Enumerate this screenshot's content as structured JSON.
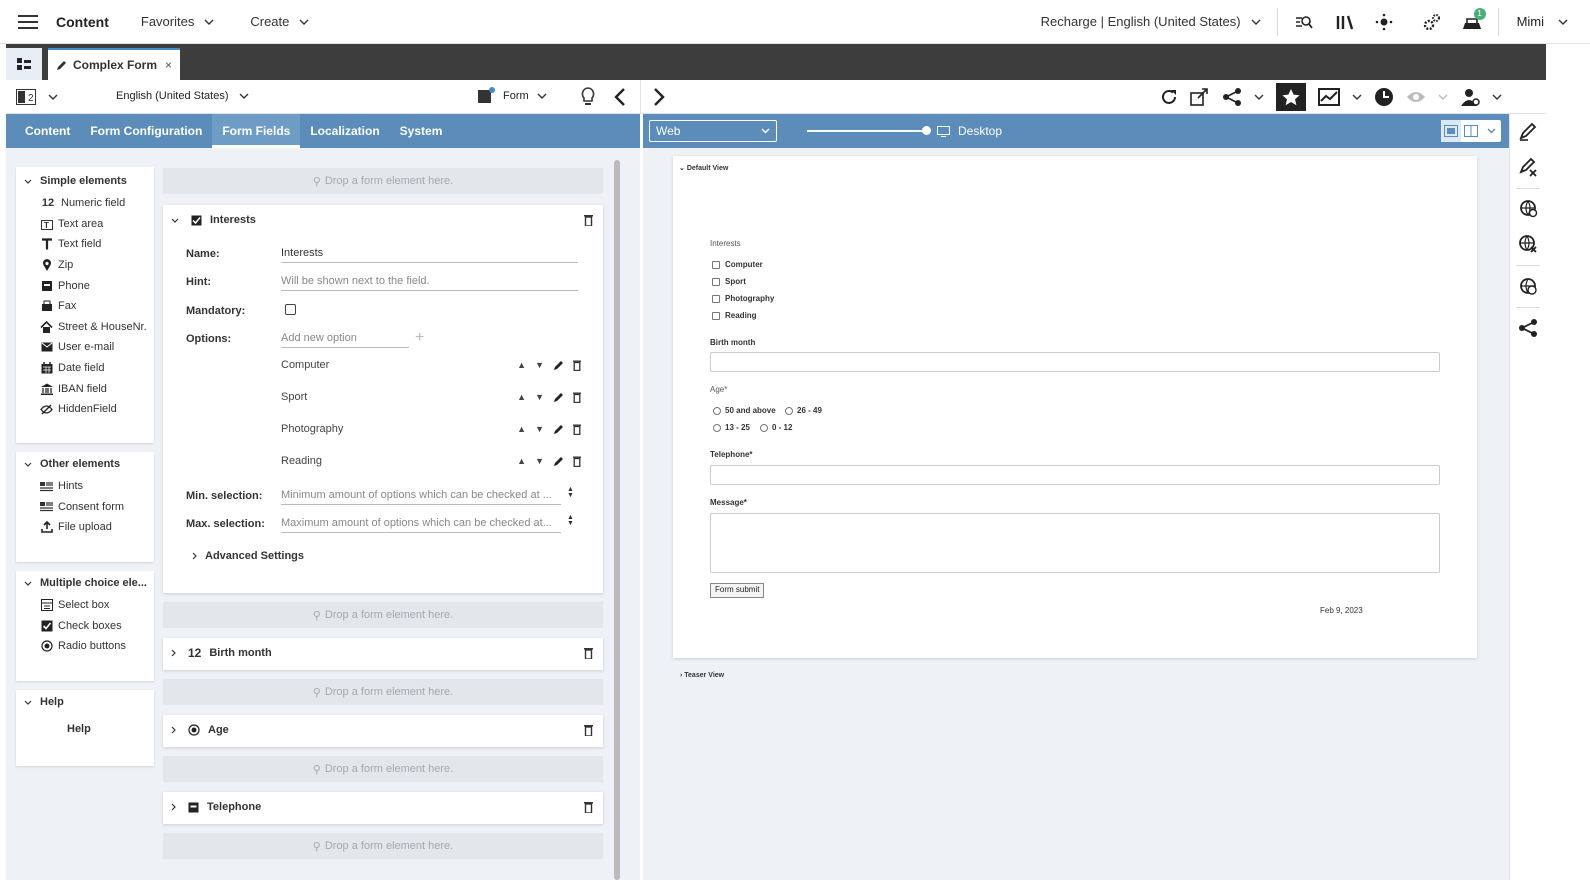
{
  "topbar": {
    "title": "Content",
    "favorites": "Favorites",
    "create": "Create",
    "site": "Recharge | English (United States)",
    "notification_count": "1",
    "user": "Mimi"
  },
  "tabbar": {
    "tab_label": "Complex Form"
  },
  "toolbar": {
    "locale": "English (United States)",
    "view": "Form"
  },
  "left_nav": [
    "Content",
    "Form Configuration",
    "Form Fields",
    "Localization",
    "System"
  ],
  "preview_bar": {
    "channel": "Web",
    "device": "Desktop"
  },
  "palette": {
    "simple": {
      "title": "Simple elements",
      "items": [
        {
          "label": "Numeric field",
          "icon": "12"
        },
        {
          "label": "Text area",
          "icon": "T"
        },
        {
          "label": "Text field",
          "icon": "T"
        },
        {
          "label": "Zip",
          "icon": "pin"
        },
        {
          "label": "Phone",
          "icon": "phone"
        },
        {
          "label": "Fax",
          "icon": "fax"
        },
        {
          "label": "Street & HouseNr.",
          "icon": "house"
        },
        {
          "label": "User e-mail",
          "icon": "mail"
        },
        {
          "label": "Date field",
          "icon": "cal"
        },
        {
          "label": "IBAN field",
          "icon": "bank"
        },
        {
          "label": "HiddenField",
          "icon": "hidden"
        }
      ]
    },
    "other": {
      "title": "Other elements",
      "items": [
        {
          "label": "Hints"
        },
        {
          "label": "Consent form"
        },
        {
          "label": "File upload"
        }
      ]
    },
    "multi": {
      "title": "Multiple choice ele...",
      "items": [
        {
          "label": "Select box"
        },
        {
          "label": "Check boxes"
        },
        {
          "label": "Radio buttons"
        }
      ]
    },
    "help": {
      "title": "Help",
      "item": "Help"
    }
  },
  "editor": {
    "drop_text": "Drop a form element here.",
    "interests": {
      "title": "Interests",
      "name_label": "Name:",
      "name_value": "Interests",
      "hint_label": "Hint:",
      "hint_placeholder": "Will be shown next to the field.",
      "mandatory_label": "Mandatory:",
      "options_label": "Options:",
      "add_option_placeholder": "Add new option",
      "options": [
        "Computer",
        "Sport",
        "Photography",
        "Reading"
      ],
      "min_label": "Min. selection:",
      "min_placeholder": "Minimum amount of options which can be checked at ...",
      "max_label": "Max. selection:",
      "max_placeholder": "Maximum amount of options which can be checked at...",
      "advanced": "Advanced Settings"
    },
    "birth_month": {
      "title": "Birth month",
      "icon": "12"
    },
    "age": {
      "title": "Age"
    },
    "telephone": {
      "title": "Telephone"
    }
  },
  "preview": {
    "default_view": "Default View",
    "interests_label": "Interests",
    "interests_options": [
      "Computer",
      "Sport",
      "Photography",
      "Reading"
    ],
    "birth_month": "Birth month",
    "age": "Age*",
    "age_options": [
      "50 and above",
      "26 - 49",
      "13 - 25",
      "0 - 12"
    ],
    "telephone": "Telephone*",
    "message": "Message*",
    "submit": "Form submit",
    "date": "Feb 9, 2023",
    "teaser_view": "Teaser View"
  }
}
